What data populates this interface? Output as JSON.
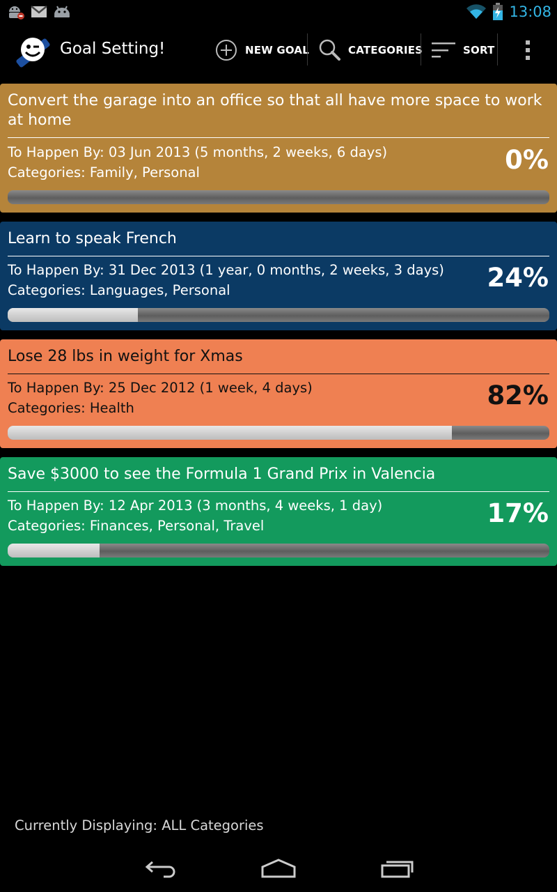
{
  "status_bar": {
    "time": "13:08",
    "icons": [
      "android-debug-icon",
      "gmail-icon",
      "android-icon",
      "wifi-icon",
      "battery-charging-icon"
    ]
  },
  "action_bar": {
    "title": "Goal Setting!",
    "new_goal_label": "NEW GOAL",
    "categories_label": "CATEGORIES",
    "sort_label": "SORT"
  },
  "goals": [
    {
      "title": "Convert the garage into an office so that all have more space to work at home",
      "date": "To Happen By: 03 Jun 2013 (5 months, 2 weeks, 6 days)",
      "categories": "Categories: Family, Personal",
      "percent_label": "0%",
      "progress": 0,
      "color": "#b5843a",
      "text_color": "#ffffff"
    },
    {
      "title": "Learn to speak French",
      "date": "To Happen By: 31 Dec 2013 (1 year, 0 months, 2 weeks, 3 days)",
      "categories": "Categories: Languages, Personal",
      "percent_label": "24%",
      "progress": 0.24,
      "color": "#0b3a64",
      "text_color": "#ffffff"
    },
    {
      "title": "Lose 28 lbs in weight for Xmas",
      "date": "To Happen By: 25 Dec 2012 (1 week, 4 days)",
      "categories": "Categories: Health",
      "percent_label": "82%",
      "progress": 0.82,
      "color": "#ef8052",
      "text_color": "#111111"
    },
    {
      "title": "Save $3000 to see the Formula 1 Grand Prix in Valencia",
      "date": "To Happen By: 12 Apr 2013 (3 months, 4 weeks, 1 day)",
      "categories": "Categories: Finances, Personal, Travel",
      "percent_label": "17%",
      "progress": 0.17,
      "color": "#139a5d",
      "text_color": "#ffffff"
    }
  ],
  "footer": {
    "text": "Currently Displaying: ALL Categories"
  },
  "nav_bar": {
    "icons": [
      "back-icon",
      "home-icon",
      "recent-apps-icon"
    ]
  }
}
